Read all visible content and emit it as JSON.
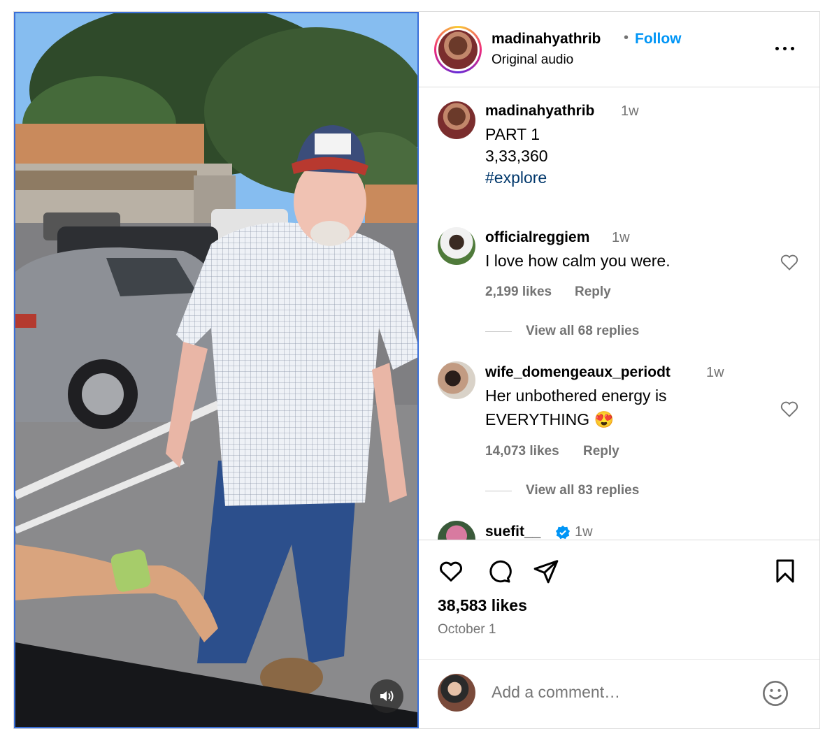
{
  "header": {
    "username": "madinahyathrib",
    "dot": "•",
    "follow_label": "Follow",
    "subtitle": "Original audio"
  },
  "caption": {
    "username": "madinahyathrib",
    "time": "1w",
    "lines": [
      "PART 1",
      "3,33,360"
    ],
    "hashtag": "#explore"
  },
  "comments": [
    {
      "username": "officialreggiem",
      "time": "1w",
      "text": "I love how calm you were.",
      "likes": "2,199 likes",
      "reply_label": "Reply",
      "view_replies": "View all 68 replies"
    },
    {
      "username": "wife_domengeaux_periodt",
      "time": "1w",
      "text_line1": "Her unbothered energy is",
      "text_line2": "EVERYTHING",
      "emoji": "😍",
      "likes": "14,073 likes",
      "reply_label": "Reply",
      "view_replies": "View all 83 replies"
    },
    {
      "username": "suefit__",
      "time": "1w",
      "verified": true
    }
  ],
  "footer": {
    "likes": "38,583 likes",
    "date": "October 1",
    "comment_placeholder": "Add a comment…"
  },
  "icons": {
    "like": "heart-icon",
    "comment": "comment-icon",
    "share": "share-icon",
    "save": "bookmark-icon",
    "more": "more-icon",
    "emoji": "emoji-icon",
    "volume": "volume-icon"
  },
  "colors": {
    "link_blue": "#0095f6",
    "hashtag": "#00376b",
    "muted": "#737373",
    "verified": "#0095f6"
  }
}
